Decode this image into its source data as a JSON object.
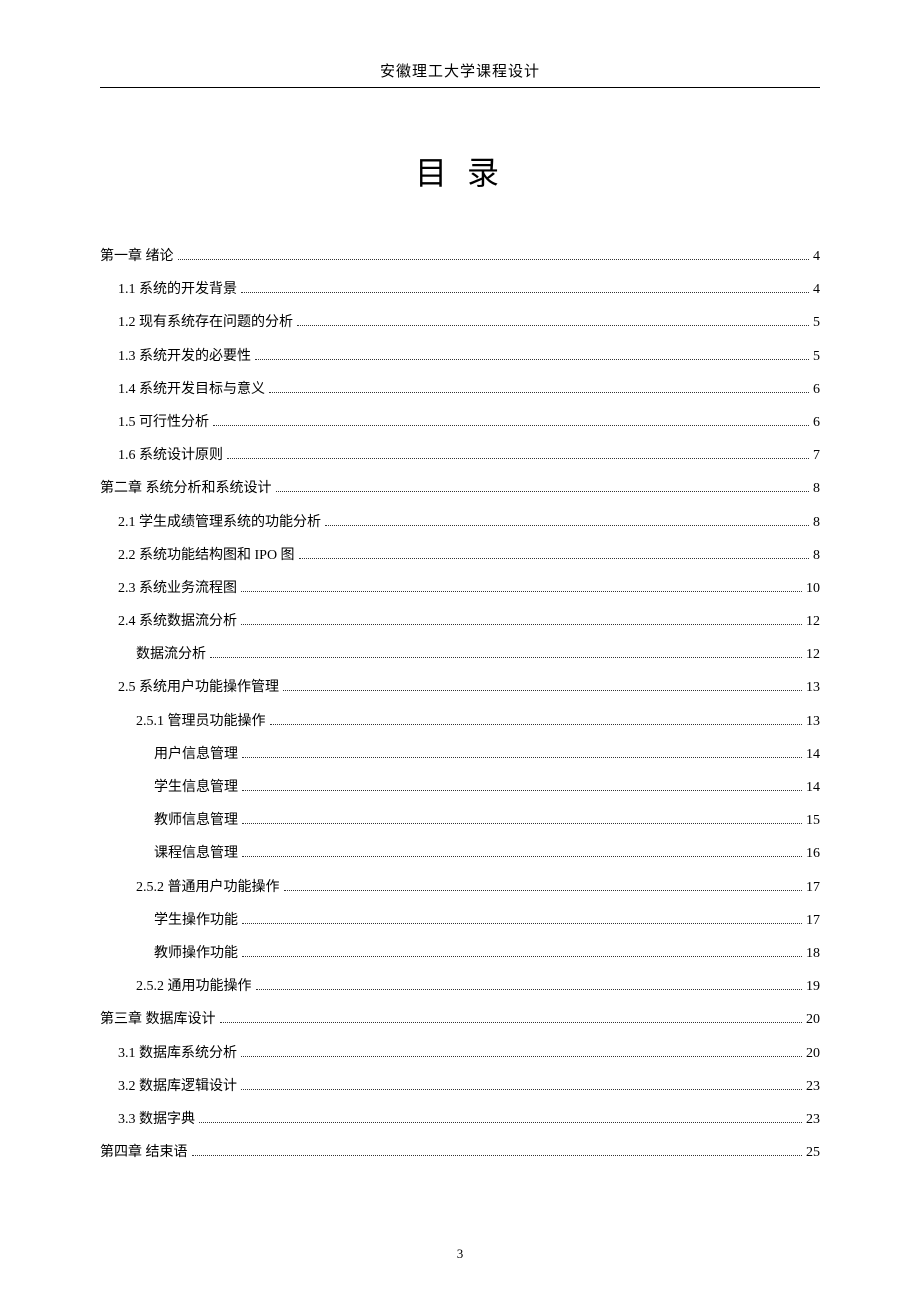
{
  "header": "安徽理工大学课程设计",
  "title": "目 录",
  "page_number": "3",
  "toc": [
    {
      "label": "第一章   绪论",
      "page": "4",
      "level": 0
    },
    {
      "label": "1.1 系统的开发背景",
      "page": "4",
      "level": 1
    },
    {
      "label": "1.2 现有系统存在问题的分析",
      "page": "5",
      "level": 1
    },
    {
      "label": "1.3 系统开发的必要性",
      "page": "5",
      "level": 1
    },
    {
      "label": "1.4 系统开发目标与意义",
      "page": "6",
      "level": 1
    },
    {
      "label": "1.5 可行性分析",
      "page": "6",
      "level": 1
    },
    {
      "label": "1.6 系统设计原则",
      "page": "7",
      "level": 1
    },
    {
      "label": "第二章   系统分析和系统设计",
      "page": "8",
      "level": 0
    },
    {
      "label": "2.1 学生成绩管理系统的功能分析",
      "page": "8",
      "level": 1
    },
    {
      "label": "2.2 系统功能结构图和 IPO 图",
      "page": "8",
      "level": 1
    },
    {
      "label": "2.3 系统业务流程图",
      "page": "10",
      "level": 1
    },
    {
      "label": "2.4 系统数据流分析",
      "page": "12",
      "level": 1
    },
    {
      "label": "数据流分析",
      "page": "12",
      "level": 2
    },
    {
      "label": "2.5 系统用户功能操作管理",
      "page": "13",
      "level": 1
    },
    {
      "label": "2.5.1 管理员功能操作",
      "page": "13",
      "level": 2
    },
    {
      "label": "用户信息管理",
      "page": "14",
      "level": 3
    },
    {
      "label": "学生信息管理",
      "page": "14",
      "level": 3
    },
    {
      "label": "教师信息管理",
      "page": "15",
      "level": 3
    },
    {
      "label": "课程信息管理",
      "page": "16",
      "level": 3
    },
    {
      "label": "2.5.2 普通用户功能操作",
      "page": "17",
      "level": 2
    },
    {
      "label": "学生操作功能",
      "page": "17",
      "level": 3
    },
    {
      "label": "教师操作功能",
      "page": "18",
      "level": 3
    },
    {
      "label": "2.5.2 通用功能操作",
      "page": "19",
      "level": 2
    },
    {
      "label": "第三章   数据库设计",
      "page": "20",
      "level": 0
    },
    {
      "label": "3.1 数据库系统分析",
      "page": "20",
      "level": 1
    },
    {
      "label": "3.2 数据库逻辑设计",
      "page": "23",
      "level": 1
    },
    {
      "label": "3.3 数据字典",
      "page": "23",
      "level": 1
    },
    {
      "label": "第四章 结束语",
      "page": "25",
      "level": 0
    }
  ]
}
